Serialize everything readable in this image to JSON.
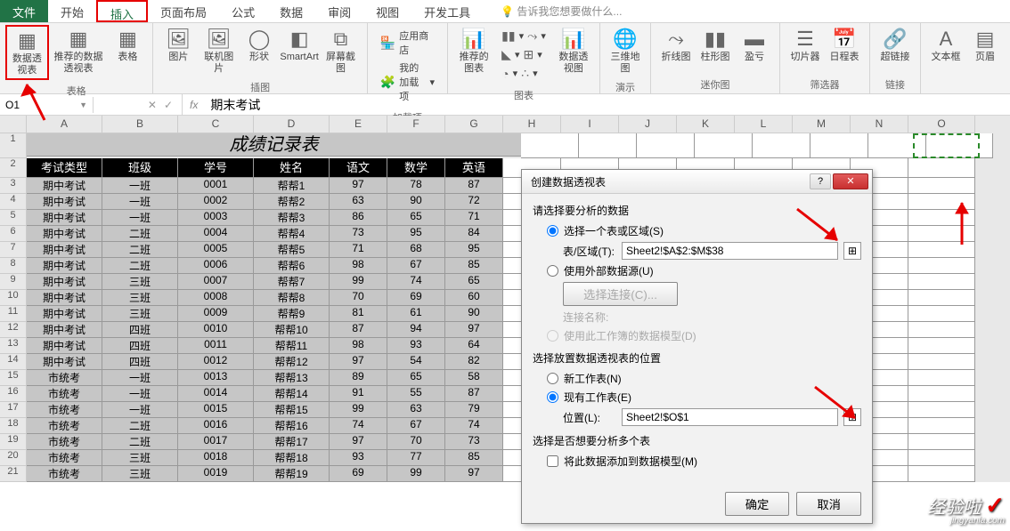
{
  "tabs": {
    "file": "文件",
    "home": "开始",
    "insert": "插入",
    "layout": "页面布局",
    "formulas": "公式",
    "data": "数据",
    "review": "审阅",
    "view": "视图",
    "developer": "开发工具",
    "tellme": "告诉我您想要做什么..."
  },
  "ribbon": {
    "pivot": "数据透视表",
    "rec_pivot": "推荐的数据透视表",
    "table": "表格",
    "pictures": "图片",
    "online_pics": "联机图片",
    "shapes": "形状",
    "smartart": "SmartArt",
    "screenshot": "屏幕截图",
    "app_store": "应用商店",
    "my_addins": "我的加载项",
    "rec_charts": "推荐的图表",
    "pivotchart": "数据透视图",
    "map3d": "三维地图",
    "sparkline_line": "折线图",
    "sparkline_col": "柱形图",
    "sparkline_wl": "盈亏",
    "slicer": "切片器",
    "timeline": "日程表",
    "hyperlink": "超链接",
    "textbox": "文本框",
    "headerfooter": "页眉",
    "grp_tables": "表格",
    "grp_illus": "插图",
    "grp_addins": "加载项",
    "grp_charts": "图表",
    "grp_demo": "演示",
    "grp_spark": "迷你图",
    "grp_filter": "筛选器",
    "grp_links": "链接"
  },
  "namebox": "O1",
  "formula": "期末考试",
  "columns": [
    "A",
    "B",
    "C",
    "D",
    "E",
    "F",
    "G",
    "H",
    "I",
    "J",
    "K",
    "L",
    "M",
    "N",
    "O"
  ],
  "sheet_title": "成绩记录表",
  "headers": [
    "考试类型",
    "班级",
    "学号",
    "姓名",
    "语文",
    "数学",
    "英语"
  ],
  "rows": [
    [
      "期中考试",
      "一班",
      "0001",
      "帮帮1",
      "97",
      "78",
      "87"
    ],
    [
      "期中考试",
      "一班",
      "0002",
      "帮帮2",
      "63",
      "90",
      "72"
    ],
    [
      "期中考试",
      "一班",
      "0003",
      "帮帮3",
      "86",
      "65",
      "71"
    ],
    [
      "期中考试",
      "二班",
      "0004",
      "帮帮4",
      "73",
      "95",
      "84"
    ],
    [
      "期中考试",
      "二班",
      "0005",
      "帮帮5",
      "71",
      "68",
      "95"
    ],
    [
      "期中考试",
      "二班",
      "0006",
      "帮帮6",
      "98",
      "67",
      "85"
    ],
    [
      "期中考试",
      "三班",
      "0007",
      "帮帮7",
      "99",
      "74",
      "65"
    ],
    [
      "期中考试",
      "三班",
      "0008",
      "帮帮8",
      "70",
      "69",
      "60"
    ],
    [
      "期中考试",
      "三班",
      "0009",
      "帮帮9",
      "81",
      "61",
      "90"
    ],
    [
      "期中考试",
      "四班",
      "0010",
      "帮帮10",
      "87",
      "94",
      "97"
    ],
    [
      "期中考试",
      "四班",
      "0011",
      "帮帮11",
      "98",
      "93",
      "64"
    ],
    [
      "期中考试",
      "四班",
      "0012",
      "帮帮12",
      "97",
      "54",
      "82"
    ],
    [
      "市统考",
      "一班",
      "0013",
      "帮帮13",
      "89",
      "65",
      "58"
    ],
    [
      "市统考",
      "一班",
      "0014",
      "帮帮14",
      "91",
      "55",
      "87"
    ],
    [
      "市统考",
      "一班",
      "0015",
      "帮帮15",
      "99",
      "63",
      "79"
    ],
    [
      "市统考",
      "二班",
      "0016",
      "帮帮16",
      "74",
      "67",
      "74"
    ],
    [
      "市统考",
      "二班",
      "0017",
      "帮帮17",
      "97",
      "70",
      "73"
    ],
    [
      "市统考",
      "三班",
      "0018",
      "帮帮18",
      "93",
      "77",
      "85"
    ],
    [
      "市统考",
      "三班",
      "0019",
      "帮帮19",
      "69",
      "99",
      "97"
    ]
  ],
  "dialog": {
    "title": "创建数据透视表",
    "sec1": "请选择要分析的数据",
    "opt_range": "选择一个表或区域(S)",
    "range_label": "表/区域(T):",
    "range_value": "Sheet2!$A$2:$M$38",
    "opt_ext": "使用外部数据源(U)",
    "choose_conn": "选择连接(C)...",
    "conn_name": "连接名称:",
    "opt_model": "使用此工作簿的数据模型(D)",
    "sec2": "选择放置数据透视表的位置",
    "opt_newws": "新工作表(N)",
    "opt_existws": "现有工作表(E)",
    "loc_label": "位置(L):",
    "loc_value": "Sheet2!$O$1",
    "sec3": "选择是否想要分析多个表",
    "opt_addmodel": "将此数据添加到数据模型(M)",
    "ok": "确定",
    "cancel": "取消"
  },
  "watermark": {
    "main": "经验啦",
    "sub": "jingyanla.com"
  }
}
